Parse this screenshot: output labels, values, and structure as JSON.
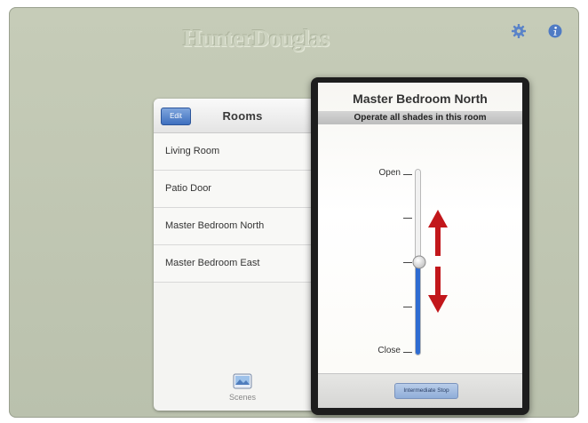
{
  "app": {
    "brand": "HunterDouglas"
  },
  "toolbar": {
    "settings_icon": "gear-icon",
    "info_icon": "info-icon"
  },
  "rooms": {
    "edit_label": "Edit",
    "title": "Rooms",
    "items": [
      {
        "label": "Living Room"
      },
      {
        "label": "Patio Door"
      },
      {
        "label": "Master Bedroom North"
      },
      {
        "label": "Master Bedroom East"
      }
    ],
    "scenes_label": "Scenes",
    "scenes_icon": "image-icon"
  },
  "shade_panel": {
    "title": "Master Bedroom North",
    "subtitle": "Operate all shades in this room",
    "open_label": "Open",
    "close_label": "Close",
    "tick_marks": [
      "—",
      "—",
      "—",
      "—",
      "—"
    ],
    "position_percent_open": 50,
    "intermediate_button": "Intermediate Stop"
  },
  "colors": {
    "background": "#bfc6b2",
    "accent_blue": "#3e6fbf",
    "slider_fill": "#2f6cd1",
    "arrow_red": "#c2171b"
  }
}
